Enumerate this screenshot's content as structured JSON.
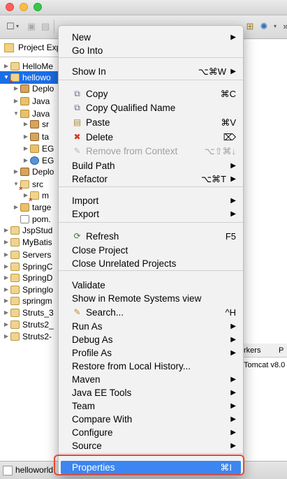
{
  "project_explorer": {
    "tab_label": "Project Exp",
    "tree": [
      {
        "label": "HelloMe",
        "arrow": "▶",
        "icon": "project-icon"
      },
      {
        "label": "hellowo",
        "arrow": "▼",
        "icon": "maven-project-error-icon",
        "selected": true
      },
      {
        "label": "Deplo",
        "arrow": "▶",
        "icon": "deployment-icon"
      },
      {
        "label": "Java",
        "arrow": "▶",
        "icon": "java-folder-icon"
      },
      {
        "label": "Java",
        "arrow": "▼",
        "icon": "java-folder-icon"
      },
      {
        "label": "sr",
        "arrow": "▶",
        "icon": "package-icon"
      },
      {
        "label": "ta",
        "arrow": "▶",
        "icon": "package-icon"
      },
      {
        "label": "EG",
        "arrow": "▶",
        "icon": "library-icon"
      },
      {
        "label": "EG",
        "arrow": "▶",
        "icon": "web-library-icon"
      },
      {
        "label": "Deplo",
        "arrow": "▶",
        "icon": "deployment-icon"
      },
      {
        "label": "src",
        "arrow": "▼",
        "icon": "folder-error-icon"
      },
      {
        "label": "m",
        "arrow": "▶",
        "icon": "folder-error-icon"
      },
      {
        "label": "targe",
        "arrow": "▶",
        "icon": "folder-icon"
      },
      {
        "label": "pom.",
        "arrow": "",
        "icon": "pom-file-icon"
      },
      {
        "label": "JspStud",
        "arrow": "▶",
        "icon": "project-icon"
      },
      {
        "label": "MyBatis",
        "arrow": "▶",
        "icon": "project-icon"
      },
      {
        "label": "Servers",
        "arrow": "▶",
        "icon": "project-icon"
      },
      {
        "label": "SpringC",
        "arrow": "▶",
        "icon": "project-icon"
      },
      {
        "label": "SpringD",
        "arrow": "▶",
        "icon": "project-icon"
      },
      {
        "label": "Springlo",
        "arrow": "▶",
        "icon": "project-icon"
      },
      {
        "label": "springm",
        "arrow": "▶",
        "icon": "project-icon"
      },
      {
        "label": "Struts_3",
        "arrow": "▶",
        "icon": "project-icon"
      },
      {
        "label": "Struts2_",
        "arrow": "▶",
        "icon": "project-icon"
      },
      {
        "label": "Struts2-",
        "arrow": "▶",
        "icon": "project-icon"
      }
    ]
  },
  "background": {
    "tab_markers": "rkers",
    "tab_p": "P",
    "server_entry": "Tomcat v8.0"
  },
  "statusbar": {
    "label": "helloworld"
  },
  "context_menu": {
    "items": [
      {
        "label": "New",
        "submenu": "▶"
      },
      {
        "label": "Go Into"
      },
      {
        "sep": true
      },
      {
        "label": "Show In",
        "shortcut": "⌥⌘W",
        "submenu": "▶"
      },
      {
        "sep": true
      },
      {
        "label": "Copy",
        "shortcut": "⌘C",
        "icon": "copy-icon"
      },
      {
        "label": "Copy Qualified Name",
        "icon": "copy-qualified-name-icon"
      },
      {
        "label": "Paste",
        "shortcut": "⌘V",
        "icon": "paste-icon"
      },
      {
        "label": "Delete",
        "shortcut": "⌦",
        "icon": "delete-icon"
      },
      {
        "label": "Remove from Context",
        "shortcut": "⌥⇧⌘↓",
        "icon": "remove-context-icon",
        "disabled": true
      },
      {
        "label": "Build Path",
        "submenu": "▶"
      },
      {
        "label": "Refactor",
        "shortcut": "⌥⌘T",
        "submenu": "▶"
      },
      {
        "sep": true
      },
      {
        "label": "Import",
        "submenu": "▶"
      },
      {
        "label": "Export",
        "submenu": "▶"
      },
      {
        "sep": true
      },
      {
        "label": "Refresh",
        "shortcut": "F5",
        "icon": "refresh-icon"
      },
      {
        "label": "Close Project"
      },
      {
        "label": "Close Unrelated Projects"
      },
      {
        "sep": true
      },
      {
        "label": "Validate"
      },
      {
        "label": "Show in Remote Systems view"
      },
      {
        "label": "Search...",
        "shortcut": "^H",
        "icon": "search-icon"
      },
      {
        "label": "Run As",
        "submenu": "▶"
      },
      {
        "label": "Debug As",
        "submenu": "▶"
      },
      {
        "label": "Profile As",
        "submenu": "▶"
      },
      {
        "label": "Restore from Local History..."
      },
      {
        "label": "Maven",
        "submenu": "▶"
      },
      {
        "label": "Java EE Tools",
        "submenu": "▶"
      },
      {
        "label": "Team",
        "submenu": "▶"
      },
      {
        "label": "Compare With",
        "submenu": "▶"
      },
      {
        "label": "Configure",
        "submenu": "▶"
      },
      {
        "label": "Source",
        "submenu": "▶"
      },
      {
        "sep": true
      },
      {
        "label": "Properties",
        "shortcut": "⌘I",
        "highlighted": true
      }
    ]
  },
  "colors": {
    "selection": "#1a6ee6",
    "menu_highlight": "#3b86f0",
    "annotation_frame": "#e04a3a"
  }
}
